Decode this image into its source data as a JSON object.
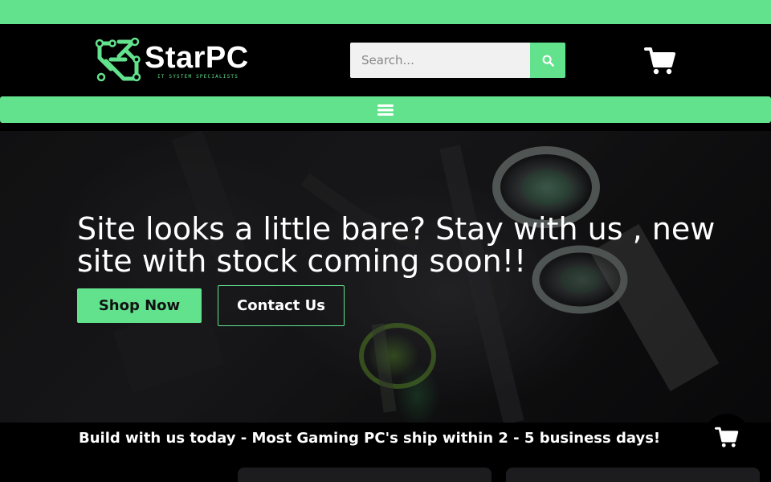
{
  "brand": {
    "name": "StarPC",
    "tagline": "IT SYSTEM SPECIALISTS",
    "accent_color": "#63e28e",
    "logo_icon": "circuit-s-logo-icon"
  },
  "search": {
    "placeholder": "Search...",
    "value": "",
    "button_icon": "search-icon"
  },
  "header": {
    "cart_icon": "shopping-cart-icon"
  },
  "nav": {
    "menu_icon": "hamburger-menu-icon"
  },
  "hero": {
    "title": "Site looks a little bare? Stay with us , new site with stock coming soon!!",
    "primary_button": "Shop Now",
    "secondary_button": "Contact Us"
  },
  "banner": {
    "text": "Build with us today - Most Gaming PC's ship within 2 - 5 business days!"
  },
  "floating_cart": {
    "icon": "shopping-cart-icon"
  }
}
